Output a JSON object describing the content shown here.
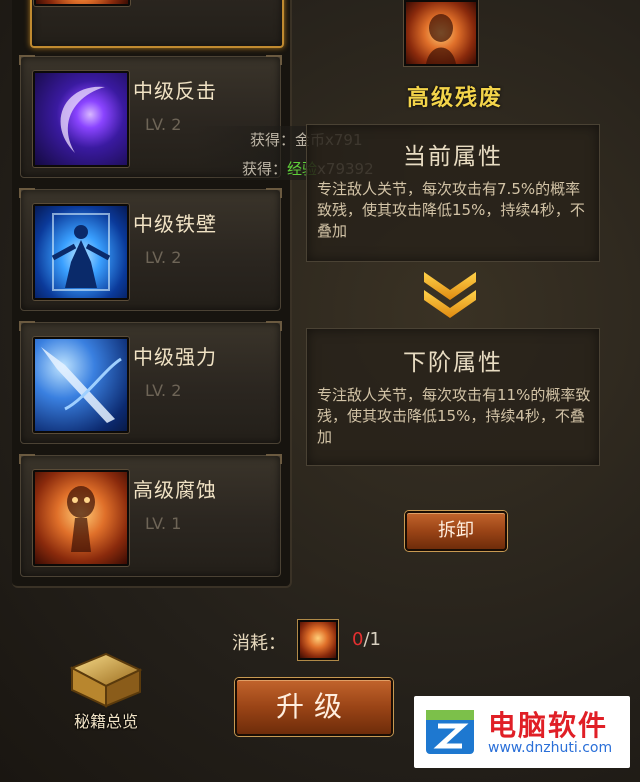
{
  "skills": [
    {
      "name": "中级反击",
      "level": "LV. 2",
      "icon": "crescent-slash-icon"
    },
    {
      "name": "中级铁壁",
      "level": "LV. 2",
      "icon": "iron-wall-icon"
    },
    {
      "name": "中级强力",
      "level": "LV. 2",
      "icon": "spear-strike-icon"
    },
    {
      "name": "高级腐蚀",
      "level": "LV. 1",
      "icon": "corrosion-icon"
    }
  ],
  "selected": {
    "title": "高级残废",
    "icon": "cripple-icon"
  },
  "reward": {
    "gold_label": "获得：金币x791",
    "exp_prefix": "获得：",
    "exp_highlight": "经验",
    "exp_amount": "x79392"
  },
  "current": {
    "heading": "当前属性",
    "text": "专注敌人关节，每次攻击有7.5%的概率致残，使其攻击降低15%，持续4秒，不叠加"
  },
  "next": {
    "heading": "下阶属性",
    "text": "专注敌人关节，每次攻击有11%的概率致残，使其攻击降低15%，持续4秒，不叠加"
  },
  "buttons": {
    "dismantle": "拆卸",
    "upgrade": "升级"
  },
  "cost": {
    "label": "消耗：",
    "have": "0",
    "need": "/1"
  },
  "overview": {
    "label": "秘籍总览"
  },
  "watermark": {
    "name": "电脑软件",
    "url": "www.dnzhuti.com"
  },
  "colors": {
    "title_gold": "#f3d44a",
    "button_orange": "#9a4416",
    "exp_green": "#5fcf3a",
    "insufficient_red": "#e43030"
  }
}
